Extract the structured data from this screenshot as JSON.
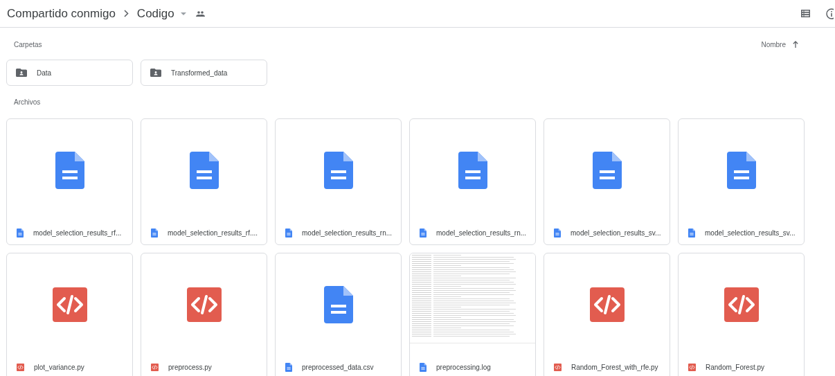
{
  "breadcrumb": {
    "parent": "Compartido conmigo",
    "current": "Codigo"
  },
  "folders_section": {
    "label": "Carpetas",
    "sort_label": "Nombre",
    "folders": [
      {
        "name": "Data"
      },
      {
        "name": "Transformed_data"
      }
    ]
  },
  "files_section": {
    "label": "Archivos",
    "files": [
      {
        "kind": "doc",
        "thumbnail": false,
        "name": "model_selection_results_rf..."
      },
      {
        "kind": "doc",
        "thumbnail": false,
        "name": "model_selection_results_rf...."
      },
      {
        "kind": "doc",
        "thumbnail": false,
        "name": "model_selection_results_rn..."
      },
      {
        "kind": "doc",
        "thumbnail": false,
        "name": "model_selection_results_rn..."
      },
      {
        "kind": "doc",
        "thumbnail": false,
        "name": "model_selection_results_sv..."
      },
      {
        "kind": "doc",
        "thumbnail": false,
        "name": "model_selection_results_sv..."
      },
      {
        "kind": "code",
        "thumbnail": false,
        "name": "plot_variance.py"
      },
      {
        "kind": "code",
        "thumbnail": false,
        "name": "preprocess.py"
      },
      {
        "kind": "doc",
        "thumbnail": false,
        "name": "preprocessed_data.csv"
      },
      {
        "kind": "doc",
        "thumbnail": true,
        "name": "preprocessing.log"
      },
      {
        "kind": "code",
        "thumbnail": false,
        "name": "Random_Forest_with_rfe.py"
      },
      {
        "kind": "code",
        "thumbnail": false,
        "name": "Random_Forest.py"
      }
    ]
  }
}
